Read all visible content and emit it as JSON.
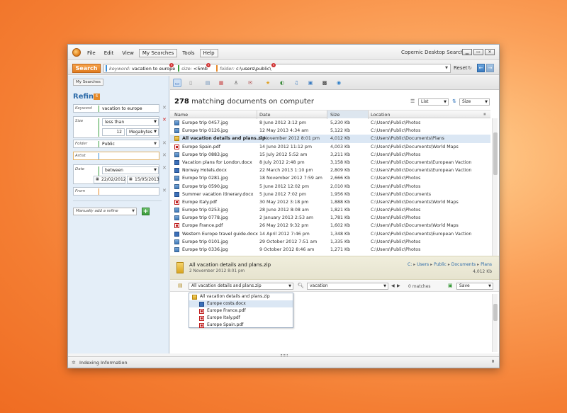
{
  "window": {
    "title": "Copernic Desktop Search",
    "controls": [
      "▁",
      "▭",
      "✕"
    ]
  },
  "menu": {
    "items": [
      "File",
      "Edit",
      "View",
      "My Searches",
      "Tools",
      "Help"
    ]
  },
  "search": {
    "button_label": "Search",
    "chips": [
      {
        "key": "keyword:",
        "value": "vacation to europe",
        "color": "#3a8fd8"
      },
      {
        "key": "size:",
        "value": "<5mb",
        "color": "#3aa040"
      },
      {
        "key": "folder:",
        "value": "c:\\users\\public\\",
        "color": "#e58a2a"
      }
    ],
    "reset_label": "Reset"
  },
  "left": {
    "my_searches": "My Searches",
    "refine_title": "Refine",
    "refine_count": "6",
    "keyword": {
      "label": "Keyword",
      "value": "vacation to europe"
    },
    "size": {
      "label": "Size",
      "op": "less than",
      "amount": "12",
      "unit": "Megabytes"
    },
    "folder": {
      "label": "Folder",
      "value": "Public"
    },
    "artist": {
      "label": "Artist",
      "value": ""
    },
    "date": {
      "label": "Date",
      "op": "between",
      "from": "22/02/2012",
      "to": "15/05/2013"
    },
    "from": {
      "label": "From",
      "value": ""
    },
    "add_refine": "Manually add a refine"
  },
  "results": {
    "count": "278",
    "count_suffix": "matching documents on computer",
    "view_mode": "List",
    "sort_by": "Size",
    "columns": {
      "name": "Name",
      "date": "Date",
      "size": "Size",
      "location": "Location"
    },
    "rows": [
      {
        "type": "jpg",
        "name": "Europe trip 0457.jpg",
        "date": "8 June 2012  3:12 pm",
        "size": "5,230 Kb",
        "location": "C:\\Users\\Public\\Photos"
      },
      {
        "type": "jpg",
        "name": "Europe trip 0126.jpg",
        "date": "12 May 2013  4:34 am",
        "size": "5,122 Kb",
        "location": "C:\\Users\\Public\\Photos"
      },
      {
        "type": "zip",
        "name": "All vacation details and plans.zip",
        "date": "2 November 2012  8:01 pm",
        "size": "4,012 Kb",
        "location": "C:\\Users\\Public\\Documents\\Plans",
        "selected": true
      },
      {
        "type": "pdf",
        "name": "Europe Spain.pdf",
        "date": "14 June 2012  11:12 pm",
        "size": "4,003 Kb",
        "location": "C:\\Users\\Public\\Documents\\World Maps"
      },
      {
        "type": "jpg",
        "name": "Europe trip 0883.jpg",
        "date": "15 July 2012  5:52 am",
        "size": "3,211 Kb",
        "location": "C:\\Users\\Public\\Photos"
      },
      {
        "type": "docx",
        "name": "Vacation plans for London.docx",
        "date": "8 July 2012  2:48 pm",
        "size": "3,158 Kb",
        "location": "C:\\Users\\Public\\Documents\\European Vaction"
      },
      {
        "type": "docx",
        "name": "Norway Hotels.docx",
        "date": "22 March 2013  1:10 pm",
        "size": "2,809 Kb",
        "location": "C:\\Users\\Public\\Documents\\European Vaction"
      },
      {
        "type": "jpg",
        "name": "Europe trip 0281.jpg",
        "date": "18 November 2012  7:59 am",
        "size": "2,666 Kb",
        "location": "C:\\Users\\Public\\Photos"
      },
      {
        "type": "jpg",
        "name": "Europe trip 0590.jpg",
        "date": "5 June 2012  12:02 pm",
        "size": "2,010 Kb",
        "location": "C:\\Users\\Public\\Photos"
      },
      {
        "type": "docx",
        "name": "Summer vacation itinerary.docx",
        "date": "5 June 2012  7:02 pm",
        "size": "1,956 Kb",
        "location": "C:\\Users\\Public\\Documents"
      },
      {
        "type": "pdf",
        "name": "Europe Italy.pdf",
        "date": "30 May 2012  3:18 pm",
        "size": "1,888 Kb",
        "location": "C:\\Users\\Public\\Documents\\World Maps"
      },
      {
        "type": "jpg",
        "name": "Europe trip 0253.jpg",
        "date": "28 June 2012  8:08 am",
        "size": "1,821 Kb",
        "location": "C:\\Users\\Public\\Photos"
      },
      {
        "type": "jpg",
        "name": "Europe trip 0778.jpg",
        "date": "2 January 2013  2:53 am",
        "size": "1,781 Kb",
        "location": "C:\\Users\\Public\\Photos"
      },
      {
        "type": "pdf",
        "name": "Europe France.pdf",
        "date": "26 May 2012  9:32 pm",
        "size": "1,602 Kb",
        "location": "C:\\Users\\Public\\Documents\\World Maps"
      },
      {
        "type": "docx",
        "name": "Western Europe travel guide.docx",
        "date": "14 April 2012  7:46 pm",
        "size": "1,348 Kb",
        "location": "C:\\Users\\Public\\Documents\\European Vaction"
      },
      {
        "type": "jpg",
        "name": "Europe trip 0101.jpg",
        "date": "29 October 2012  7:51 am",
        "size": "1,335 Kb",
        "location": "C:\\Users\\Public\\Photos"
      },
      {
        "type": "jpg",
        "name": "Europe trip 0336.jpg",
        "date": "9 October 2012  8:46 am",
        "size": "1,271 Kb",
        "location": "C:\\Users\\Public\\Photos"
      }
    ]
  },
  "preview": {
    "name": "All vacation details and plans.zip",
    "date": "2 November 2012  8:01 pm",
    "breadcrumb": [
      "C:",
      "Users",
      "Public",
      "Documents",
      "Plans"
    ],
    "size": "4,012 Kb",
    "archive_select": "All vacation details and plans.zip",
    "find_value": "vacation",
    "match_count": "0 matches",
    "save_label": "Save",
    "tree": [
      {
        "type": "zip",
        "name": "All vacation details and plans.zip",
        "indent": 0
      },
      {
        "type": "docx",
        "name": "Europe costs.docx",
        "indent": 1,
        "selected": true
      },
      {
        "type": "pdf",
        "name": "Europe France.pdf",
        "indent": 1
      },
      {
        "type": "pdf",
        "name": "Europe Italy.pdf",
        "indent": 1
      },
      {
        "type": "pdf",
        "name": "Europe Spain.pdf",
        "indent": 1
      }
    ]
  },
  "status": {
    "text": "Indexing Information"
  }
}
